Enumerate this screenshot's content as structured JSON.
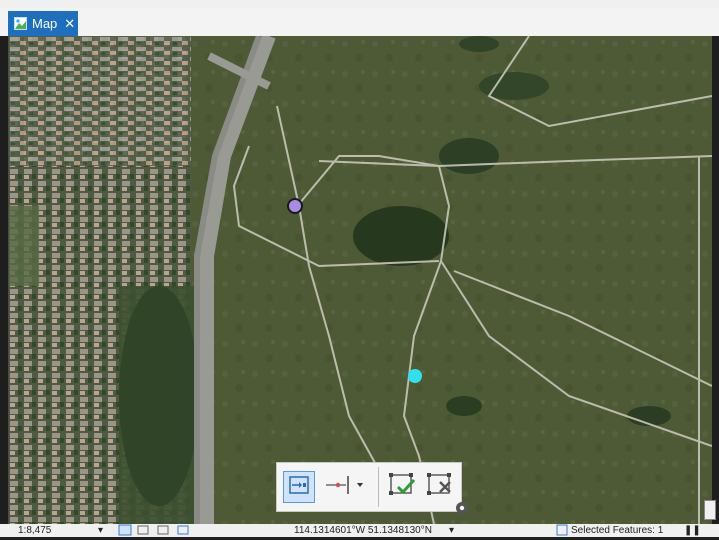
{
  "tab": {
    "title": "Map",
    "close_glyph": "✕",
    "icon": "map-icon"
  },
  "status": {
    "scale": "1:8,475",
    "scale_caret": "▾",
    "coordinates": "114.1314601°W 51.1348130°N",
    "coord_caret": "▾",
    "selected_features": "Selected Features: 1",
    "pause_glyph": "❚❚"
  },
  "toolbar": {
    "buttons": [
      "snap-to-feature-icon",
      "vertex-split-icon",
      "finish-sketch-icon",
      "cancel-sketch-icon",
      "gear-icon"
    ]
  },
  "colors": {
    "purple_point": "#a98be6",
    "cyan_point": "#2fe0f0",
    "tab_blue": "#1f6fbf",
    "finish_check": "#2e9c3a"
  }
}
